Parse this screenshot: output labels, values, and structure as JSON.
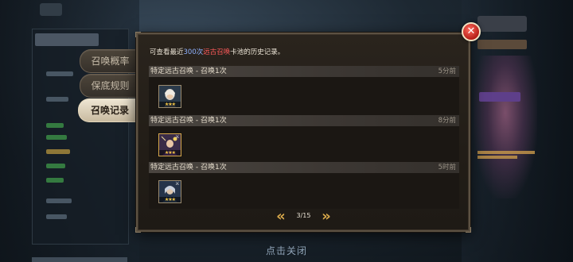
{
  "tabs": [
    {
      "label": "召唤概率",
      "active": false
    },
    {
      "label": "保底规则",
      "active": false
    },
    {
      "label": "召唤记录",
      "active": true
    }
  ],
  "info": {
    "prefix": "可查看最近",
    "count": "300次",
    "pool": "远古召唤",
    "suffix": "卡池的历史记录。"
  },
  "records": [
    {
      "title": "特定远古召唤 - 召唤1次",
      "time": "5分前",
      "hero_icon": "hero-portrait-silver-hair-icon",
      "stars": "★★★"
    },
    {
      "title": "特定远古召唤 - 召唤1次",
      "time": "8分前",
      "hero_icon": "hero-portrait-purple-mage-icon",
      "stars": "★★★"
    },
    {
      "title": "特定远古召唤 - 召唤1次",
      "time": "5时前",
      "hero_icon": "hero-portrait-blue-knight-icon",
      "stars": "★★★"
    }
  ],
  "pager": {
    "text": "3/15",
    "prev_icon": "double-chevron-left-icon",
    "next_icon": "double-chevron-right-icon"
  },
  "close_icon": "close-x-icon",
  "close_hint": "点击关闭",
  "colors": {
    "info_count": "#8fb2ff",
    "info_pool": "#ff5a5a",
    "pager_arrow": "#d9a94b",
    "close_button": "#d8352a"
  }
}
